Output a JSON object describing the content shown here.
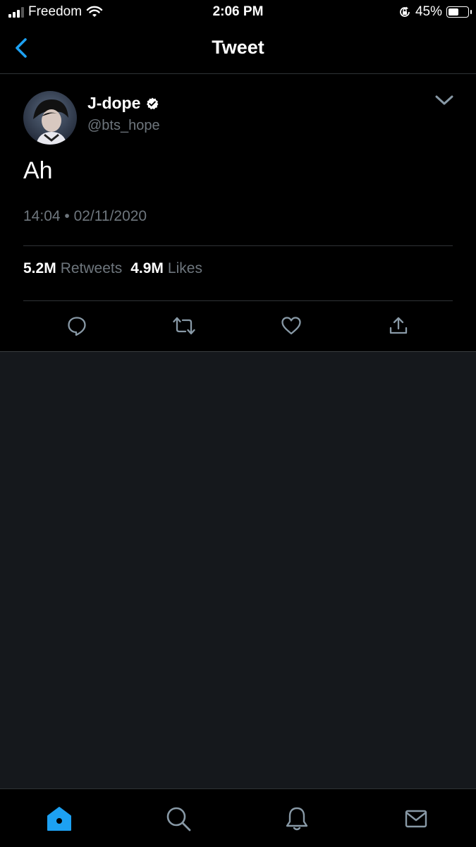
{
  "status_bar": {
    "carrier": "Freedom",
    "time": "2:06 PM",
    "battery_percent_label": "45%",
    "battery_level": 0.45,
    "signal_bars": 3,
    "icons": [
      "wifi-icon",
      "orientation-lock-icon",
      "battery-icon"
    ]
  },
  "nav": {
    "title": "Tweet",
    "back_icon": "chevron-left-icon"
  },
  "tweet": {
    "author_name": "J-dope",
    "handle": "@bts_hope",
    "verified": true,
    "text": "Ah",
    "timestamp": "14:04 • 02/11/2020",
    "stats": {
      "retweets_count": "5.2M",
      "retweets_label": "Retweets",
      "likes_count": "4.9M",
      "likes_label": "Likes"
    },
    "actions": [
      "reply-icon",
      "retweet-icon",
      "like-icon",
      "share-icon"
    ]
  },
  "tab_bar": {
    "tabs": [
      "home-icon",
      "search-icon",
      "notifications-icon",
      "messages-icon"
    ],
    "active": "home-icon"
  },
  "colors": {
    "accent": "#1da1f2",
    "background": "#000000",
    "empty_area": "#15181c",
    "secondary_text": "#6e767d",
    "divider": "#2f3336"
  }
}
